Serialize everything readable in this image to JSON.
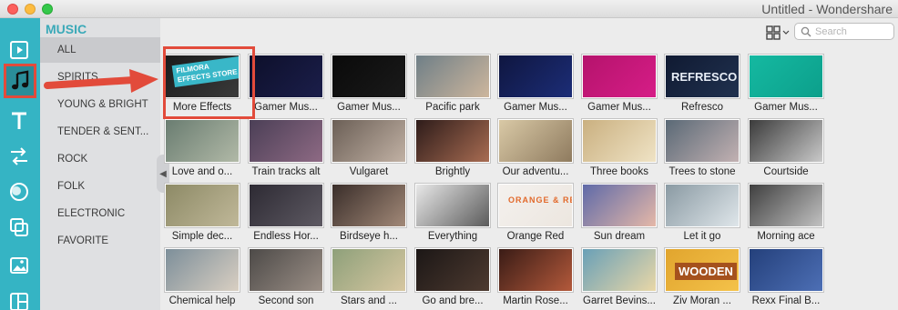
{
  "window": {
    "title": "Untitled - Wondershare"
  },
  "rail": [
    {
      "name": "media-icon"
    },
    {
      "name": "music-note-icon",
      "active": true
    },
    {
      "name": "text-icon"
    },
    {
      "name": "transitions-icon"
    },
    {
      "name": "filters-icon"
    },
    {
      "name": "overlays-icon"
    },
    {
      "name": "elements-icon"
    },
    {
      "name": "split-screen-icon"
    }
  ],
  "categories": {
    "header": "MUSIC",
    "items": [
      "ALL",
      "SPIRITS",
      "YOUNG & BRIGHT",
      "TENDER & SENT...",
      "ROCK",
      "FOLK",
      "ELECTRONIC",
      "FAVORITE"
    ],
    "selected": "ALL"
  },
  "search": {
    "placeholder": "Search"
  },
  "tracks": [
    {
      "title": "More Effects",
      "colors": [
        "#1b1b1b",
        "#3a3a3a"
      ],
      "badge": "FILMORA\nEFFECTS STORE"
    },
    {
      "title": "Gamer Mus...",
      "colors": [
        "#0d0f2a",
        "#1b1e4a"
      ]
    },
    {
      "title": "Gamer Mus...",
      "colors": [
        "#0a0a0a",
        "#1a1a1a"
      ]
    },
    {
      "title": "Pacific park",
      "colors": [
        "#6f7f87",
        "#cdb69d"
      ]
    },
    {
      "title": "Gamer Mus...",
      "colors": [
        "#0f1640",
        "#1c2d77"
      ]
    },
    {
      "title": "Gamer Mus...",
      "colors": [
        "#b5136c",
        "#d61d87"
      ]
    },
    {
      "title": "Refresco",
      "colors": [
        "#101a32",
        "#20314f"
      ],
      "badge": "REFRESCO"
    },
    {
      "title": "Gamer Mus...",
      "colors": [
        "#15b9a1",
        "#0c9f8b"
      ]
    },
    {
      "title": "Love and o...",
      "colors": [
        "#6a7d71",
        "#b1b9a7"
      ]
    },
    {
      "title": "Train tracks alt",
      "colors": [
        "#4b3f56",
        "#8e6a84"
      ]
    },
    {
      "title": "Vulgaret",
      "colors": [
        "#6b5f56",
        "#c1b1a4"
      ]
    },
    {
      "title": "Brightly",
      "colors": [
        "#2e1c1a",
        "#a86c52"
      ]
    },
    {
      "title": "Our adventu...",
      "colors": [
        "#d9c9a6",
        "#8f7b5f"
      ]
    },
    {
      "title": "Three books",
      "colors": [
        "#cab080",
        "#efe3c5"
      ]
    },
    {
      "title": "Trees to stone",
      "colors": [
        "#5a6976",
        "#c2b1b2"
      ]
    },
    {
      "title": "Courtside",
      "colors": [
        "#3b3b3b",
        "#c9c9c9"
      ]
    },
    {
      "title": "Simple dec...",
      "colors": [
        "#8d8a66",
        "#c0b899"
      ]
    },
    {
      "title": "Endless Hor...",
      "colors": [
        "#2d2a33",
        "#5e5a63"
      ]
    },
    {
      "title": "Birdseye h...",
      "colors": [
        "#3a2e2a",
        "#a28978"
      ]
    },
    {
      "title": "Everything",
      "colors": [
        "#e8e8e8",
        "#5b5b5b"
      ]
    },
    {
      "title": "Orange Red",
      "colors": [
        "#f4f1ee",
        "#ece6df"
      ],
      "badge": "ORANGE & RED"
    },
    {
      "title": "Sun dream",
      "colors": [
        "#5f6aa8",
        "#e5b8a8"
      ]
    },
    {
      "title": "Let it go",
      "colors": [
        "#8a9aa3",
        "#dfe6ea"
      ]
    },
    {
      "title": "Morning ace",
      "colors": [
        "#3f3f3f",
        "#c2c2c2"
      ]
    },
    {
      "title": "Chemical help",
      "colors": [
        "#7d8f9a",
        "#d9cfc2"
      ]
    },
    {
      "title": "Second son",
      "colors": [
        "#4d4a48",
        "#9b8f86"
      ]
    },
    {
      "title": "Stars and ...",
      "colors": [
        "#8ea07a",
        "#d7c7a1"
      ]
    },
    {
      "title": "Go and bre...",
      "colors": [
        "#1c1716",
        "#4d3a30"
      ]
    },
    {
      "title": "Martin Rose...",
      "colors": [
        "#3a1c16",
        "#b3593b"
      ]
    },
    {
      "title": "Garret Bevins...",
      "colors": [
        "#6aa0b7",
        "#e9d7a7"
      ]
    },
    {
      "title": "Ziv Moran ...",
      "colors": [
        "#e1a52e",
        "#f4c24a"
      ],
      "badge": "WOODEN"
    },
    {
      "title": "Rexx Final B...",
      "colors": [
        "#24407b",
        "#4d6fb5"
      ]
    }
  ]
}
